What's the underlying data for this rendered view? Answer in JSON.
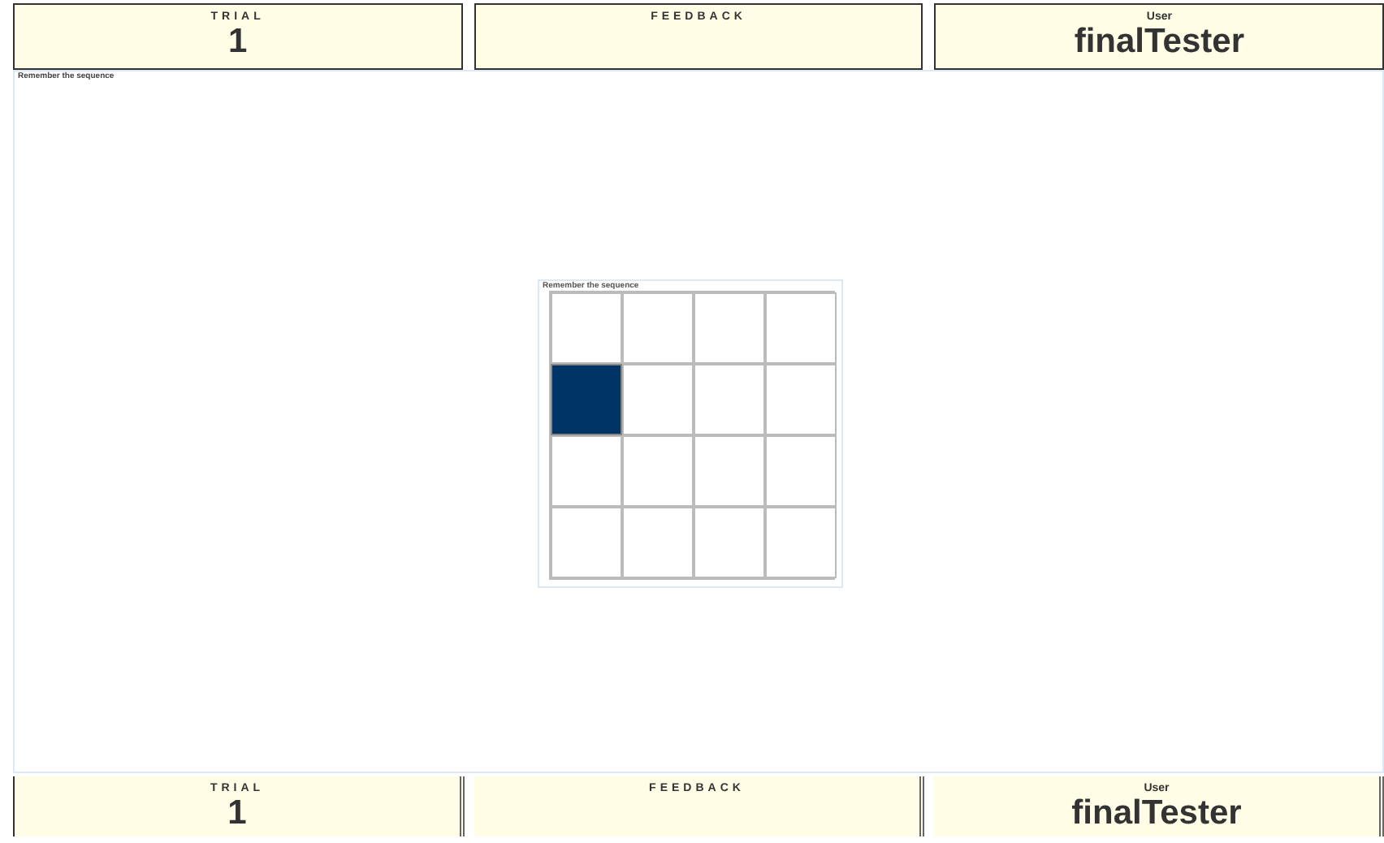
{
  "top_bar": [
    {
      "label": "TRIAL",
      "kind": "spaced",
      "value": "1"
    },
    {
      "label": "FEEDBACK",
      "kind": "spaced"
    },
    {
      "label": "User",
      "kind": "plain",
      "value": "finalTester"
    }
  ],
  "stage": {
    "label": "Remember the sequence",
    "grid": {
      "label": "Remember the sequence",
      "rows": [
        [
          {
            "lit": false
          },
          {
            "lit": false
          },
          {
            "lit": false
          },
          {
            "lit": false
          }
        ],
        [
          {
            "lit": true
          },
          {
            "lit": false
          },
          {
            "lit": false
          },
          {
            "lit": false
          }
        ],
        [
          {
            "lit": false
          },
          {
            "lit": false
          },
          {
            "lit": false
          },
          {
            "lit": false
          }
        ],
        [
          {
            "lit": false
          },
          {
            "lit": false
          },
          {
            "lit": false
          },
          {
            "lit": false
          }
        ]
      ]
    }
  },
  "bottom_bar": [
    {
      "label": "TRIAL",
      "kind": "spaced",
      "value": "1"
    },
    {
      "label": "FEEDBACK",
      "kind": "spaced"
    },
    {
      "label": "User",
      "kind": "plain",
      "value": "finalTester"
    }
  ]
}
